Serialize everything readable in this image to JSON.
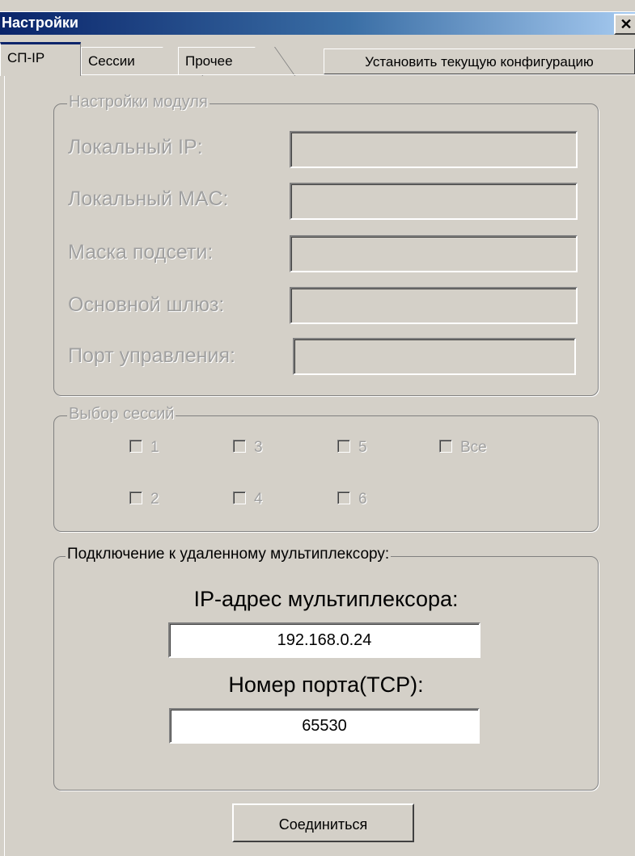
{
  "window": {
    "title": "Настройки"
  },
  "tabs": [
    {
      "label": "СП-IP"
    },
    {
      "label": "Сессии"
    },
    {
      "label": "Прочее"
    }
  ],
  "apply_button": "Установить текущую конфигурацию",
  "module": {
    "legend": "Настройки модуля",
    "fields": [
      {
        "label": "Локальный IP:",
        "value": ""
      },
      {
        "label": "Локальный MAC:",
        "value": ""
      },
      {
        "label": "Маска подсети:",
        "value": ""
      },
      {
        "label": "Основной шлюз:",
        "value": ""
      },
      {
        "label": "Порт управления:",
        "value": ""
      }
    ]
  },
  "sessions": {
    "legend": "Выбор сессий",
    "checkboxes": [
      {
        "label": "1",
        "checked": false
      },
      {
        "label": "3",
        "checked": false
      },
      {
        "label": "5",
        "checked": false
      },
      {
        "label": "Все",
        "checked": false
      },
      {
        "label": "2",
        "checked": false
      },
      {
        "label": "4",
        "checked": false
      },
      {
        "label": "6",
        "checked": false
      }
    ]
  },
  "remote": {
    "legend": "Подключение к удаленному мультиплексору:",
    "ip_label": "IP-адрес мультиплексора:",
    "ip_value": "192.168.0.24",
    "port_label": "Номер порта(TCP):",
    "port_value": "65530"
  },
  "connect_button": "Соединиться"
}
